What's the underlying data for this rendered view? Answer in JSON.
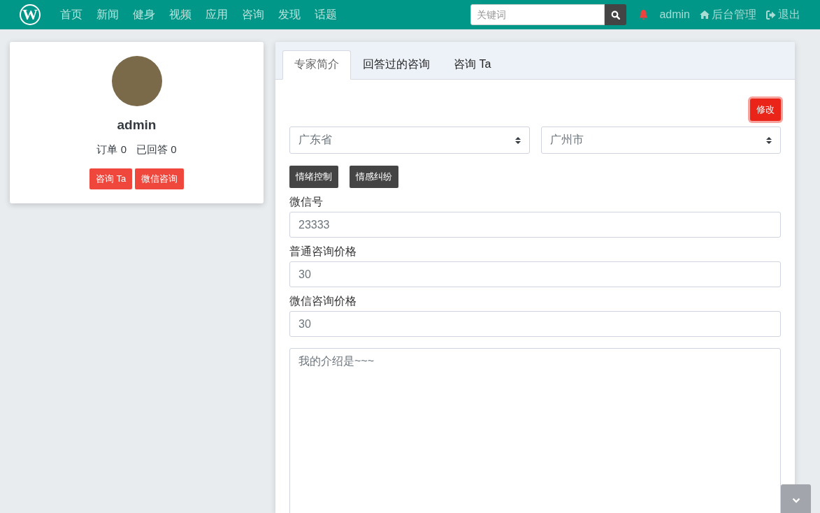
{
  "navbar": {
    "logo": "W",
    "menu": [
      {
        "label": "首页"
      },
      {
        "label": "新闻"
      },
      {
        "label": "健身"
      },
      {
        "label": "视频"
      },
      {
        "label": "应用"
      },
      {
        "label": "咨询"
      },
      {
        "label": "发现"
      },
      {
        "label": "话题"
      }
    ],
    "search": {
      "placeholder": "关键词"
    },
    "user": "admin",
    "admin_link": "后台管理",
    "logout": "退出"
  },
  "profile": {
    "name": "admin",
    "stats": [
      {
        "label": "订单",
        "value": "0"
      },
      {
        "label": "已回答",
        "value": "0"
      }
    ],
    "buttons": [
      "咨询 Ta",
      "微信咨询"
    ]
  },
  "tabs": [
    {
      "label": "专家简介",
      "selected": true
    },
    {
      "label": "回答过的咨询",
      "selected": false
    },
    {
      "label": "咨询 Ta",
      "selected": false
    }
  ],
  "form": {
    "edit_button": "修改",
    "province": "广东省",
    "city": "广州市",
    "tags": [
      "情绪控制",
      "情感纠纷"
    ],
    "fields": [
      {
        "label": "微信号",
        "value": "23333"
      },
      {
        "label": "普通咨询价格",
        "value": "30"
      },
      {
        "label": "微信咨询价格",
        "value": "30"
      }
    ],
    "intro": "我的介绍是~~~"
  }
}
